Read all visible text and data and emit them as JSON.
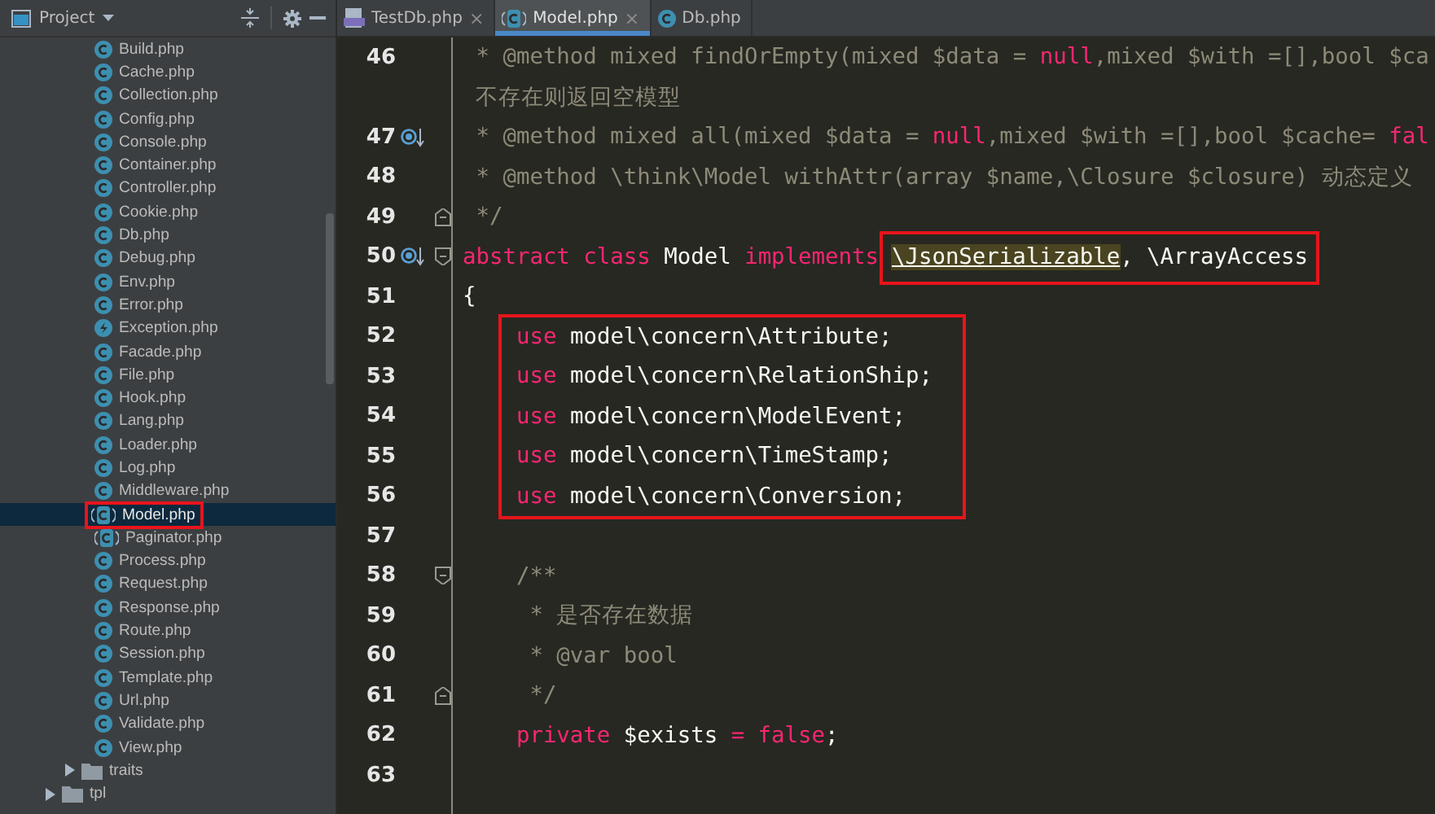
{
  "sidebar": {
    "title": "Project",
    "tree_items": [
      {
        "kind": "class",
        "label": "Build.php",
        "selected": false,
        "annotated": false
      },
      {
        "kind": "class",
        "label": "Cache.php",
        "selected": false,
        "annotated": false
      },
      {
        "kind": "class",
        "label": "Collection.php",
        "selected": false,
        "annotated": false
      },
      {
        "kind": "class",
        "label": "Config.php",
        "selected": false,
        "annotated": false
      },
      {
        "kind": "class",
        "label": "Console.php",
        "selected": false,
        "annotated": false
      },
      {
        "kind": "class",
        "label": "Container.php",
        "selected": false,
        "annotated": false
      },
      {
        "kind": "class",
        "label": "Controller.php",
        "selected": false,
        "annotated": false
      },
      {
        "kind": "class",
        "label": "Cookie.php",
        "selected": false,
        "annotated": false
      },
      {
        "kind": "class",
        "label": "Db.php",
        "selected": false,
        "annotated": false
      },
      {
        "kind": "class",
        "label": "Debug.php",
        "selected": false,
        "annotated": false
      },
      {
        "kind": "class",
        "label": "Env.php",
        "selected": false,
        "annotated": false
      },
      {
        "kind": "class",
        "label": "Error.php",
        "selected": false,
        "annotated": false
      },
      {
        "kind": "exception",
        "label": "Exception.php",
        "selected": false,
        "annotated": false
      },
      {
        "kind": "class",
        "label": "Facade.php",
        "selected": false,
        "annotated": false
      },
      {
        "kind": "class",
        "label": "File.php",
        "selected": false,
        "annotated": false
      },
      {
        "kind": "class",
        "label": "Hook.php",
        "selected": false,
        "annotated": false
      },
      {
        "kind": "class",
        "label": "Lang.php",
        "selected": false,
        "annotated": false
      },
      {
        "kind": "class",
        "label": "Loader.php",
        "selected": false,
        "annotated": false
      },
      {
        "kind": "class",
        "label": "Log.php",
        "selected": false,
        "annotated": false
      },
      {
        "kind": "class",
        "label": "Middleware.php",
        "selected": false,
        "annotated": false
      },
      {
        "kind": "abstract",
        "label": "Model.php",
        "selected": true,
        "annotated": true
      },
      {
        "kind": "abstract",
        "label": "Paginator.php",
        "selected": false,
        "annotated": false
      },
      {
        "kind": "class",
        "label": "Process.php",
        "selected": false,
        "annotated": false
      },
      {
        "kind": "class",
        "label": "Request.php",
        "selected": false,
        "annotated": false
      },
      {
        "kind": "class",
        "label": "Response.php",
        "selected": false,
        "annotated": false
      },
      {
        "kind": "class",
        "label": "Route.php",
        "selected": false,
        "annotated": false
      },
      {
        "kind": "class",
        "label": "Session.php",
        "selected": false,
        "annotated": false
      },
      {
        "kind": "class",
        "label": "Template.php",
        "selected": false,
        "annotated": false
      },
      {
        "kind": "class",
        "label": "Url.php",
        "selected": false,
        "annotated": false
      },
      {
        "kind": "class",
        "label": "Validate.php",
        "selected": false,
        "annotated": false
      },
      {
        "kind": "class",
        "label": "View.php",
        "selected": false,
        "annotated": false
      },
      {
        "kind": "folder",
        "label": "traits",
        "expanded": false,
        "selected": false,
        "annotated": false
      }
    ],
    "outer_items": [
      {
        "kind": "folder",
        "label": "tpl",
        "expanded": false,
        "selected": false,
        "annotated": false
      }
    ]
  },
  "tabs": [
    {
      "kind": "php",
      "label": "TestDb.php",
      "close": "×",
      "selected": false
    },
    {
      "kind": "abstract",
      "label": "Model.php",
      "close": "×",
      "selected": true
    },
    {
      "kind": "class",
      "label": "Db.php",
      "selected": false
    }
  ],
  "code": [
    {
      "kind": "line",
      "number": "46",
      "tokens": [
        {
          "kind": "comment",
          "text": " * @method mixed findOrEmpty(mixed $data = "
        },
        {
          "kind": "keyword",
          "text": "null"
        },
        {
          "kind": "comment",
          "text": ",mixed $with =[],bool $ca"
        }
      ]
    },
    {
      "kind": "line",
      "tokens": [
        {
          "kind": "comment",
          "text": " 不存在则返回空模型"
        }
      ]
    },
    {
      "kind": "line",
      "number": "47",
      "override_marker": true,
      "tokens": [
        {
          "kind": "comment",
          "text": " * @method mixed all(mixed $data = "
        },
        {
          "kind": "keyword",
          "text": "null"
        },
        {
          "kind": "comment",
          "text": ",mixed $with =[],bool $cache= "
        },
        {
          "kind": "keyword",
          "text": "fal"
        }
      ]
    },
    {
      "kind": "line",
      "number": "48",
      "tokens": [
        {
          "kind": "comment",
          "text": " * @method \\think\\Model withAttr(array $name,\\Closure $closure) 动态定义"
        }
      ]
    },
    {
      "kind": "line",
      "number": "49",
      "fold_end": true,
      "tokens": [
        {
          "kind": "comment",
          "text": " */"
        }
      ]
    },
    {
      "kind": "line",
      "number": "50",
      "override_marker": true,
      "fold_start": true,
      "tokens": [
        {
          "kind": "keyword",
          "text": "abstract"
        },
        {
          "kind": "keyword",
          "text": " class"
        },
        {
          "kind": "plain",
          "text": " Model "
        },
        {
          "kind": "keyword",
          "text": "implements"
        },
        {
          "kind": "highlight",
          "text": "\\JsonSerializable",
          "boxed": true
        },
        {
          "kind": "plain",
          "text": ", \\ArrayAccess",
          "boxed": true
        }
      ]
    },
    {
      "kind": "line",
      "number": "51",
      "tokens": [
        {
          "kind": "plain",
          "text": "{"
        }
      ]
    },
    {
      "kind": "box",
      "lines": [
        {
          "kind": "line",
          "number": "52",
          "tokens": [
            {
              "kind": "keyword",
              "text": "use"
            },
            {
              "kind": "plain",
              "text": " model\\concern\\Attribute;"
            }
          ]
        },
        {
          "kind": "line",
          "number": "53",
          "tokens": [
            {
              "kind": "keyword",
              "text": "use"
            },
            {
              "kind": "plain",
              "text": " model\\concern\\RelationShip;"
            }
          ]
        },
        {
          "kind": "line",
          "number": "54",
          "tokens": [
            {
              "kind": "keyword",
              "text": "use"
            },
            {
              "kind": "plain",
              "text": " model\\concern\\ModelEvent;"
            }
          ]
        },
        {
          "kind": "line",
          "number": "55",
          "tokens": [
            {
              "kind": "keyword",
              "text": "use"
            },
            {
              "kind": "plain",
              "text": " model\\concern\\TimeStamp;"
            }
          ]
        },
        {
          "kind": "line",
          "number": "56",
          "tokens": [
            {
              "kind": "keyword",
              "text": "use"
            },
            {
              "kind": "plain",
              "text": " model\\concern\\Conversion;"
            }
          ]
        }
      ]
    },
    {
      "kind": "line",
      "number": "57"
    },
    {
      "kind": "line",
      "number": "58",
      "fold_start": true,
      "tokens": [
        {
          "kind": "comment",
          "text": "    /**"
        }
      ]
    },
    {
      "kind": "line",
      "number": "59",
      "tokens": [
        {
          "kind": "comment",
          "text": "     * 是否存在数据"
        }
      ]
    },
    {
      "kind": "line",
      "number": "60",
      "tokens": [
        {
          "kind": "comment",
          "text": "     * @var bool"
        }
      ]
    },
    {
      "kind": "line",
      "number": "61",
      "fold_end": true,
      "tokens": [
        {
          "kind": "comment",
          "text": "     */"
        }
      ]
    },
    {
      "kind": "line",
      "number": "62",
      "tokens": [
        {
          "kind": "keyword",
          "text": "    private"
        },
        {
          "kind": "plain",
          "text": " $exists "
        },
        {
          "kind": "keyword",
          "text": "= false"
        },
        {
          "kind": "plain",
          "text": ";"
        }
      ]
    },
    {
      "kind": "line",
      "number": "63"
    }
  ]
}
